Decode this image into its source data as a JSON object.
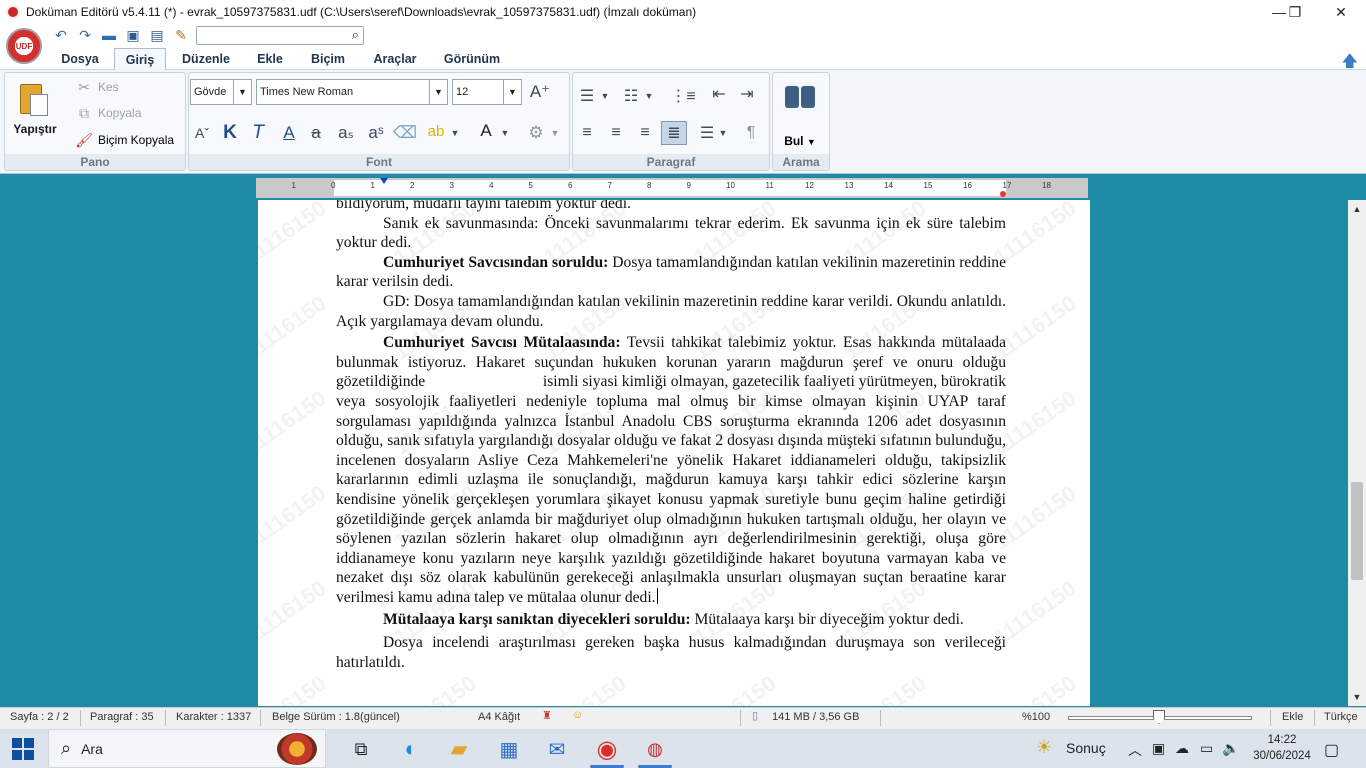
{
  "window": {
    "title": "Doküman Editörü v5.4.11 (*) - evrak_10597375831.udf (C:\\Users\\seref\\Downloads\\evrak_10597375831.udf) (İmzalı doküman)",
    "minimize": "—",
    "maximize": "❐",
    "close": "✕"
  },
  "logo_text": "UDF",
  "menu": {
    "tabs": [
      "Dosya",
      "Giriş",
      "Düzenle",
      "Ekle",
      "Biçim",
      "Araçlar",
      "Görünüm"
    ],
    "active": "Giriş"
  },
  "ribbon": {
    "pano": {
      "label": "Pano",
      "paste": "Yapıştır",
      "cut": "Kes",
      "copy": "Kopyala",
      "format_painter": "Biçim Kopyala"
    },
    "font": {
      "label": "Font",
      "style": "Gövde",
      "family": "Times New Roman",
      "size": "12"
    },
    "paragraph": {
      "label": "Paragraf"
    },
    "search": {
      "label": "Arama",
      "find": "Bul"
    }
  },
  "ruler": {
    "numbers": [
      "1",
      "0",
      "1",
      "2",
      "3",
      "4",
      "5",
      "6",
      "7",
      "8",
      "9",
      "10",
      "11",
      "12",
      "13",
      "14",
      "15",
      "16",
      "17",
      "18"
    ]
  },
  "document": {
    "watermark": "11116150",
    "top_cut_line": "bildiyorum, müdafii tayini talebim yoktur dedi.",
    "paragraphs": [
      {
        "bold": "",
        "text": "Sanık ek savunmasında: Önceki savunmalarımı tekrar ederim. Ek savunma için ek süre talebim yoktur dedi."
      },
      {
        "bold": "Cumhuriyet Savcısından soruldu:",
        "text": " Dosya tamamlandığından katılan vekilinin mazeretinin reddine karar verilsin dedi."
      },
      {
        "bold": "",
        "text": "GD: Dosya tamamlandığından katılan vekilinin mazeretinin reddine karar verildi. Okundu anlatıldı. Açık yargılamaya devam olundu."
      },
      {
        "bold": "Cumhuriyet Savcısı Mütalaasında:",
        "text": " Tevsii tahkikat talebimiz yoktur. Esas hakkında mütalaada bulunmak istiyoruz. Hakaret suçundan hukuken korunan yararın mağdurun şeref ve onuru olduğu gözetildiğinde                              isimli siyasi kimliği olmayan, gazetecilik faaliyeti yürütmeyen, bürokratik veya sosyolojik faaliyetleri nedeniyle topluma mal olmuş bir kimse olmayan kişinin UYAP taraf sorgulaması yapıldığında yalnızca İstanbul Anadolu CBS soruşturma ekranında 1206 adet dosyasının olduğu, sanık sıfatıyla yargılandığı dosyalar olduğu ve fakat 2 dosyası dışında müşteki sıfatının bulunduğu, incelenen dosyaların Asliye Ceza Mahkemeleri'ne yönelik Hakaret iddianameleri olduğu, takipsizlik kararlarının edimli uzlaşma ile sonuçlandığı, mağdurun kamuya karşı tahkir edici sözlerine karşın kendisine yönelik gerçekleşen yorumlara şikayet konusu yapmak suretiyle bunu geçim haline getirdiği gözetildiğinde gerçek anlamda bir mağduriyet olup olmadığının hukuken tartışmalı olduğu, her olayın ve söylenen yazılan sözlerin hakaret olup olmadığının ayrı değerlendirilmesinin gerektiği, oluşa göre iddianameye konu yazıların neye karşılık yazıldığı gözetildiğinde hakaret boyutuna varmayan kaba ve nezaket dışı söz olarak kabulünün gerekeceği anlaşılmakla unsurları oluşmayan suçtan beraatine karar verilmesi kamu adına talep ve mütalaa olunur dedi."
      },
      {
        "bold": "Mütalaaya karşı sanıktan diyecekleri soruldu:",
        "text": " Mütalaaya karşı bir diyeceğim yoktur dedi."
      },
      {
        "bold": "",
        "text": "Dosya incelendi araştırılması gereken başka husus kalmadığından duruşmaya son verileceği hatırlatıldı."
      }
    ]
  },
  "status": {
    "page": "Sayfa : 2 / 2",
    "paragraph": "Paragraf : 35",
    "characters": "Karakter : 1337",
    "version": "Belge Sürüm : 1.8(güncel)",
    "paper": "A4 Kâğıt",
    "memory": "141 MB / 3,56 GB",
    "zoom": "%100",
    "zoom_level_percent": 100,
    "mode": "Ekle",
    "language": "Türkçe"
  },
  "taskbar": {
    "search_placeholder": "Ara",
    "weather": "Sonuç",
    "time": "14:22",
    "date": "30/06/2024"
  }
}
